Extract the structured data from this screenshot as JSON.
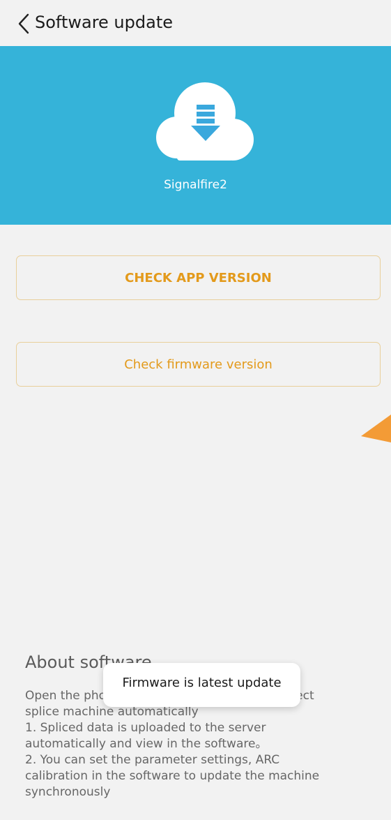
{
  "header": {
    "back_icon": "chevron-left-icon",
    "title": "Software update"
  },
  "hero": {
    "icon": "cloud-download-icon",
    "background_color": "#35b3d9",
    "device_name": "Signalfire2"
  },
  "actions": {
    "check_app_label": "CHECK APP VERSION",
    "check_firmware_label": "Check firmware version",
    "accent_color": "#e39a1b"
  },
  "about": {
    "title": "About software",
    "lines": [
      "Open the phone bluetooth, the software connect",
      "splice machine automatically",
      "1. Spliced data is uploaded to the server",
      "automatically and view in the software。",
      "2. You can set the parameter settings, ARC",
      "calibration in the software to update the machine",
      "synchronously"
    ]
  },
  "toast": {
    "message": "Firmware is latest update"
  }
}
